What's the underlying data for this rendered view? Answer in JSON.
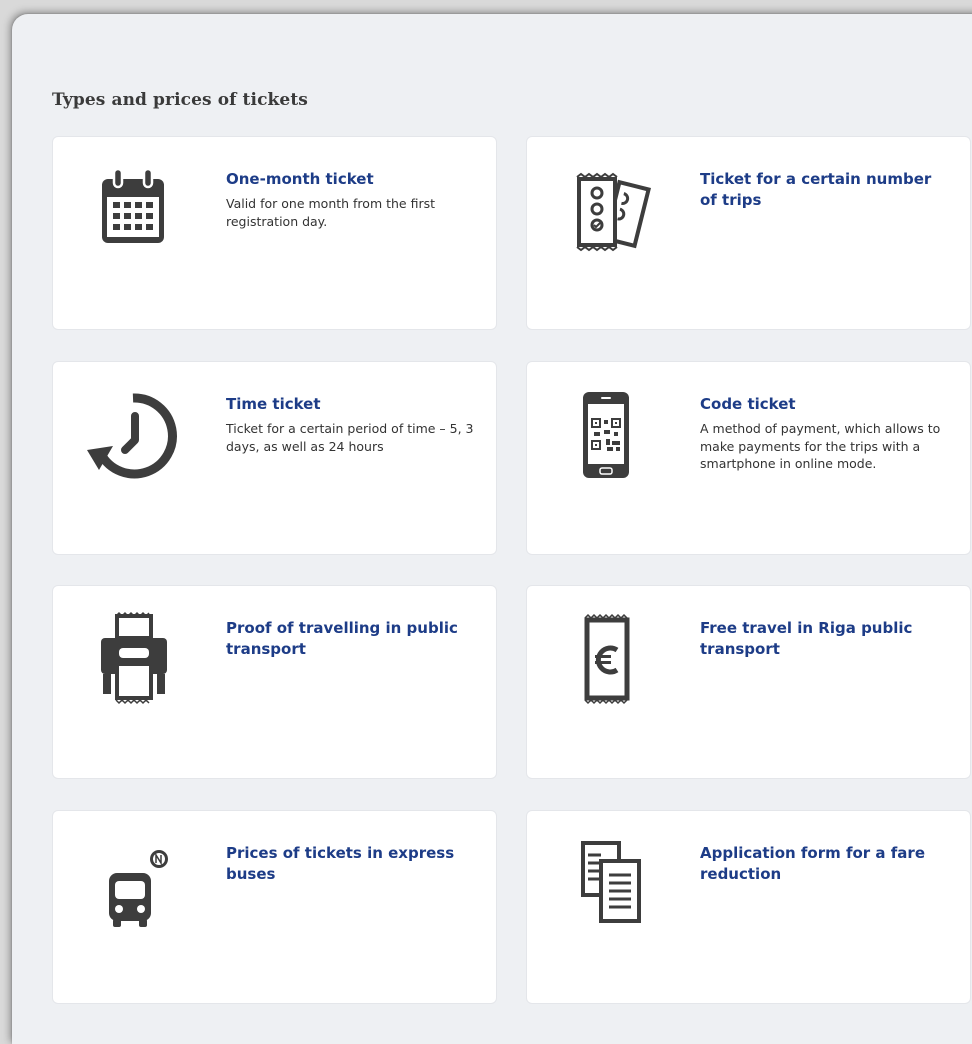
{
  "page": {
    "title": "Types and prices of tickets"
  },
  "cards": [
    {
      "icon": "calendar-icon",
      "title": "One-month ticket",
      "desc": "Valid for one month from the first registration day."
    },
    {
      "icon": "trip-tickets-icon",
      "title": "Ticket for a certain number of trips",
      "desc": ""
    },
    {
      "icon": "clock-back-icon",
      "title": "Time ticket",
      "desc": "Ticket for a certain period of time – 5, 3 days, as well as 24 hours"
    },
    {
      "icon": "smartphone-qr-icon",
      "title": "Code ticket",
      "desc": "A method of payment, which allows to make payments for the trips with a smartphone in online mode."
    },
    {
      "icon": "ticket-printer-icon",
      "title": "Proof of travelling in public transport",
      "desc": ""
    },
    {
      "icon": "euro-ticket-icon",
      "title": "Free travel in Riga public transport",
      "desc": ""
    },
    {
      "icon": "express-bus-icon",
      "title": "Prices of tickets in express buses",
      "desc": ""
    },
    {
      "icon": "documents-icon",
      "title": "Application form for a fare reduction",
      "desc": ""
    }
  ],
  "colors": {
    "title": "#1d3c87",
    "icon": "#3d3d3d",
    "background": "#eef0f3"
  }
}
